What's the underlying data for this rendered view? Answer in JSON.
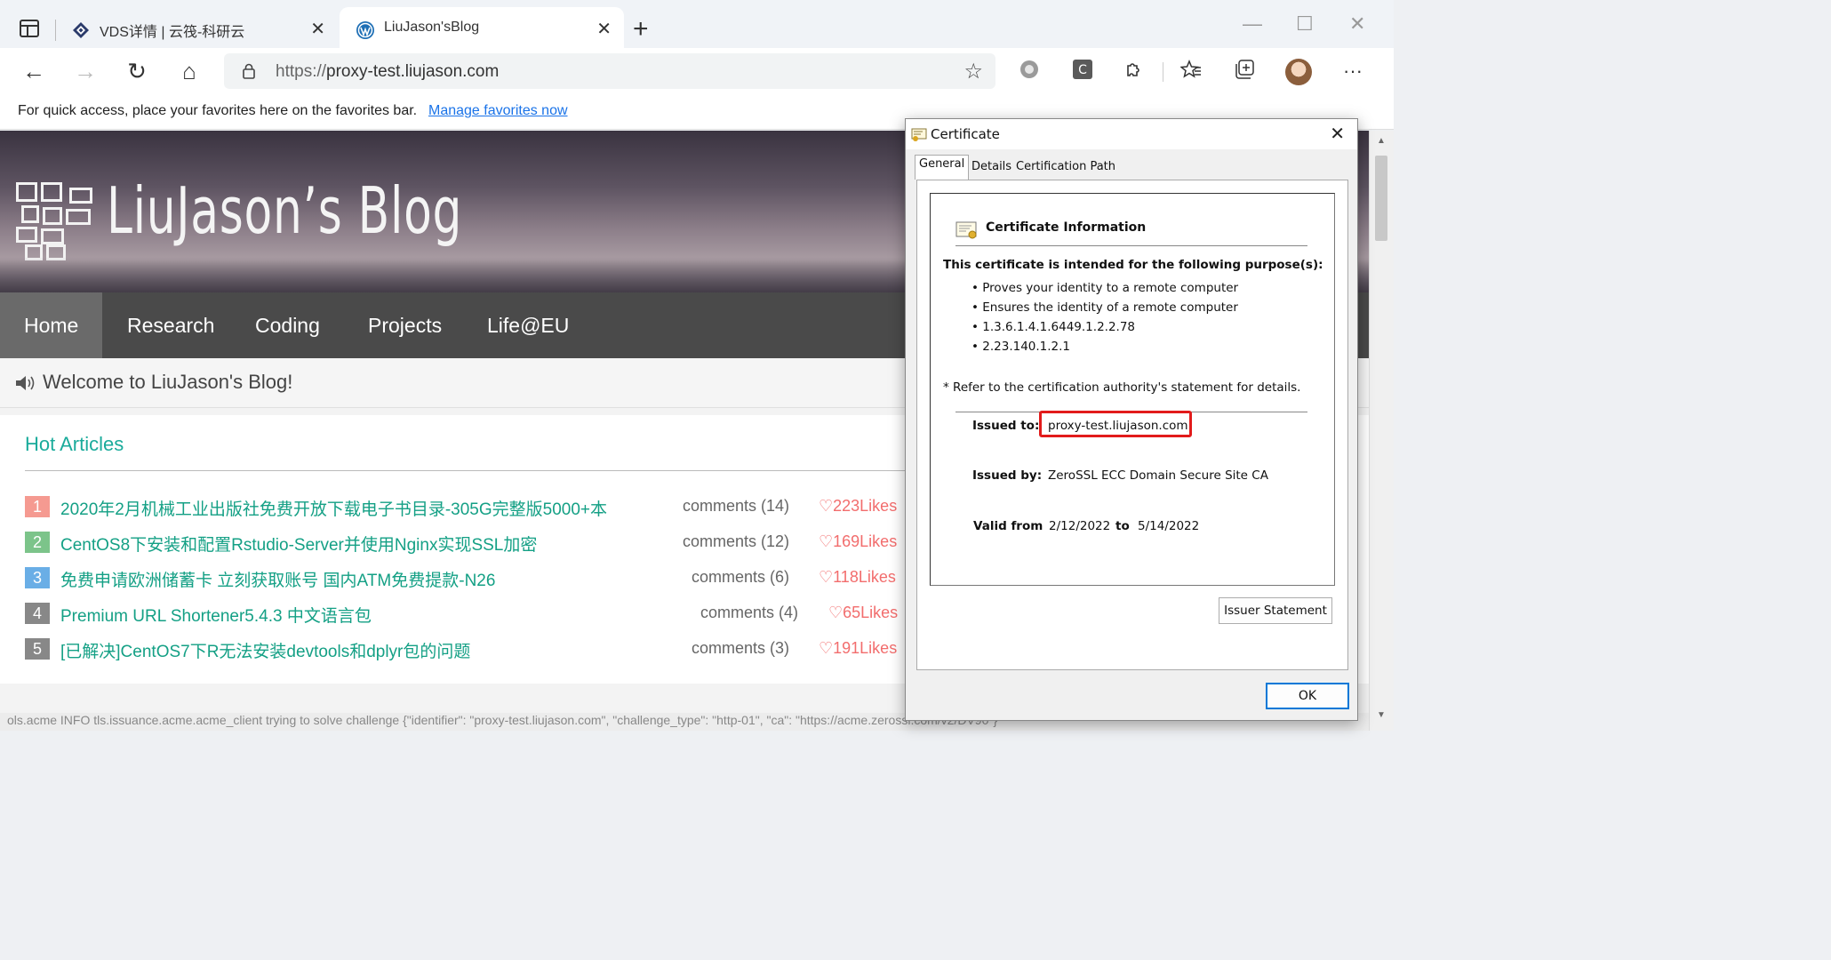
{
  "browser": {
    "tabs": [
      {
        "title": "VDS详情 | 云筏-科研云",
        "close": "✕"
      },
      {
        "title": "LiuJason'sBlog",
        "close": "✕"
      }
    ],
    "new_tab": "+",
    "window_controls": {
      "minimize": "—",
      "maximize": "☐",
      "close": "✕"
    },
    "address": {
      "protocol": "https://",
      "host": "proxy-test.liujason.com"
    },
    "nav": {
      "back": "←",
      "forward": "→",
      "refresh": "↻",
      "home": "⌂"
    },
    "toolbar_icons": [
      "add-favorite-icon",
      "extension-circle-icon",
      "extension-c-icon",
      "puzzle-icon",
      "favorites-icon",
      "collections-icon",
      "avatar",
      "more-icon"
    ],
    "more": "···"
  },
  "favorites_bar": {
    "text": "For quick access, place your favorites here on the favorites bar.",
    "link": "Manage favorites now"
  },
  "blog": {
    "title": "LiuJason’s Blog",
    "nav": [
      "Home",
      "Research",
      "Coding",
      "Projects",
      "Life@EU"
    ],
    "welcome": "Welcome to LiuJason's Blog!",
    "hot_title": "Hot Articles",
    "articles": [
      {
        "rank": "1",
        "title": "2020年2月机械工业出版社免费开放下载电子书目录-305G完整版5000+本",
        "comments": "comments (14)",
        "likes": "♡223Likes",
        "color": "#f59a91"
      },
      {
        "rank": "2",
        "title": "CentOS8下安装和配置Rstudio-Server并使用Nginx实现SSL加密",
        "comments": "comments (12)",
        "likes": "♡169Likes",
        "color": "#7cc48a"
      },
      {
        "rank": "3",
        "title": "免费申请欧洲储蓄卡 立刻获取账号 国内ATM免费提款-N26",
        "comments": "comments (6)",
        "likes": "♡118Likes",
        "color": "#6aaee6"
      },
      {
        "rank": "4",
        "title": "Premium URL Shortener5.4.3 中文语言包",
        "comments": "comments (4)",
        "likes": "♡65Likes",
        "color": "#888888"
      },
      {
        "rank": "5",
        "title": "[已解决]CentOS7下R无法安装devtools和dplyr包的问题",
        "comments": "comments (3)",
        "likes": "♡191Likes",
        "color": "#888888"
      }
    ],
    "footer_log": "ols.acme INFO     tls.issuance.acme.acme_client   trying to solve challenge     {\"identifier\": \"proxy-test.liujason.com\", \"challenge_type\": \"http-01\", \"ca\": \"https://acme.zerossl.com/v2/DV90\"}"
  },
  "certificate": {
    "window_title": "Certificate",
    "close": "✕",
    "tabs": [
      "General",
      "Details",
      "Certification Path"
    ],
    "heading": "Certificate Information",
    "purpose_heading": "This certificate is intended for the following purpose(s):",
    "purposes": [
      "• Proves your identity to a remote computer",
      "• Ensures the identity of a remote computer",
      "• 1.3.6.1.4.1.6449.1.2.2.78",
      "• 2.23.140.1.2.1"
    ],
    "refer": "* Refer to the certification authority's statement for details.",
    "issued_to_label": "Issued to:",
    "issued_to": "proxy-test.liujason.com",
    "issued_by_label": "Issued by:",
    "issued_by": "ZeroSSL ECC Domain Secure Site CA",
    "valid_from_label": "Valid from",
    "valid_from": "2/12/2022",
    "to_label": "to",
    "valid_to": "5/14/2022",
    "issuer_button": "Issuer Statement",
    "ok_button": "OK",
    "highlight_color": "#e21b1b"
  }
}
